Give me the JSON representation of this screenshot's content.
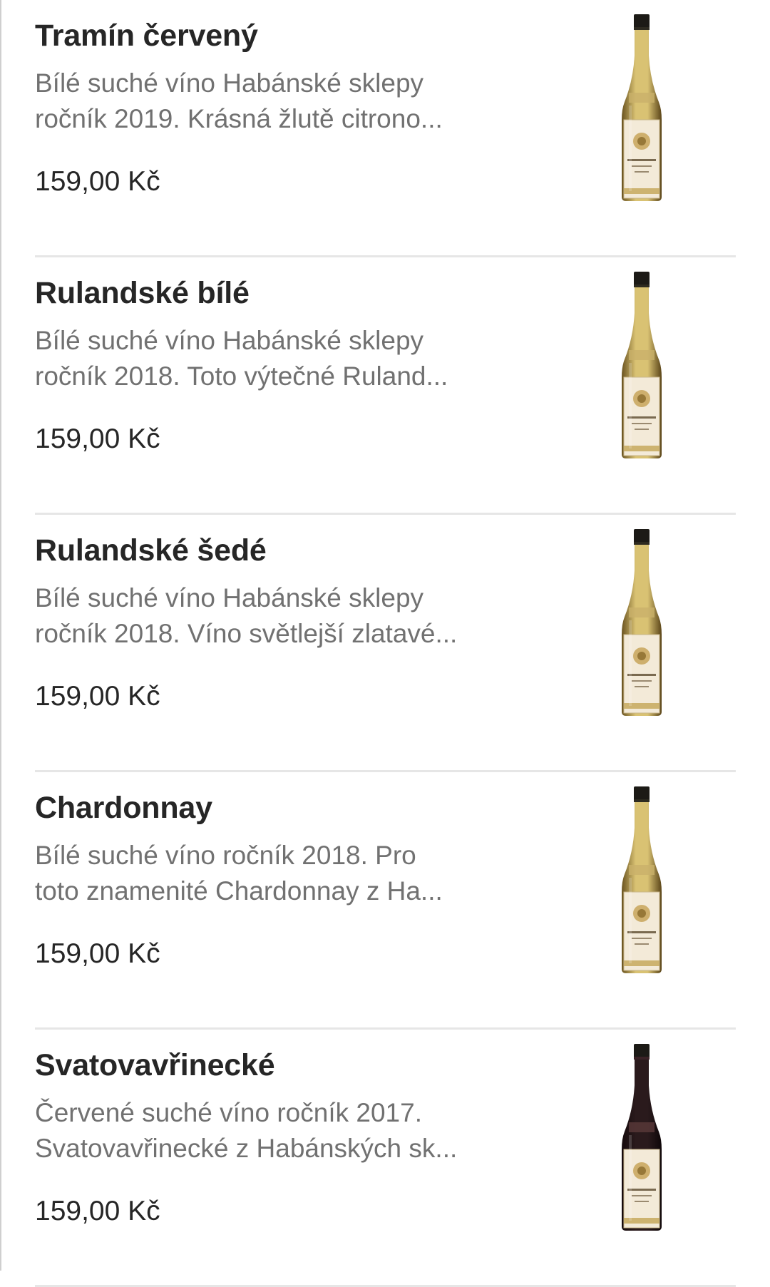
{
  "products": [
    {
      "name": "Tramín červený",
      "description_line1": "Bílé suché víno Habánské sklepy",
      "description_line2": "ročník 2019. Krásná žlutě citrono...",
      "price": "159,00 Kč",
      "bottle_color": "#d9c273",
      "bottle_icon": "wine-bottle-icon"
    },
    {
      "name": "Rulandské bílé",
      "description_line1": "Bílé suché víno Habánské sklepy",
      "description_line2": "ročník 2018. Toto výtečné Ruland...",
      "price": "159,00 Kč",
      "bottle_color": "#d9c273",
      "bottle_icon": "wine-bottle-icon"
    },
    {
      "name": "Rulandské šedé",
      "description_line1": "Bílé suché víno Habánské sklepy",
      "description_line2": "ročník 2018. Víno světlejší zlatavé...",
      "price": "159,00 Kč",
      "bottle_color": "#d9c273",
      "bottle_icon": "wine-bottle-icon"
    },
    {
      "name": "Chardonnay",
      "description_line1": "Bílé suché víno ročník 2018. Pro",
      "description_line2": "toto znamenité Chardonnay z Ha...",
      "price": "159,00 Kč",
      "bottle_color": "#d9c273",
      "bottle_icon": "wine-bottle-icon"
    },
    {
      "name": "Svatovavřinecké",
      "description_line1": "Červené suché víno ročník 2017.",
      "description_line2": "Svatovavřinecké z Habánských sk...",
      "price": "159,00 Kč",
      "bottle_color": "#2a1a1c",
      "bottle_icon": "wine-bottle-icon"
    }
  ],
  "colors": {
    "title": "#262626",
    "description": "#717171",
    "divider": "#e6e6e6"
  }
}
